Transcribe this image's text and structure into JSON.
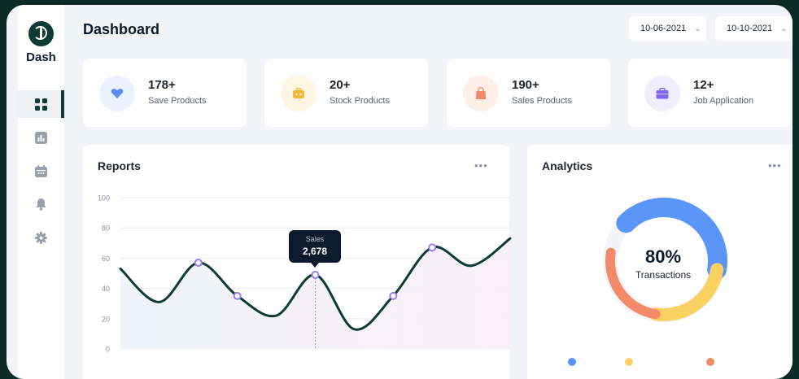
{
  "app": {
    "brand": "Dash",
    "title": "Dashboard"
  },
  "nav": [
    {
      "name": "grid-icon",
      "active": true
    },
    {
      "name": "bar-chart-icon",
      "active": false
    },
    {
      "name": "calendar-icon",
      "active": false
    },
    {
      "name": "bell-icon",
      "active": false
    },
    {
      "name": "gear-icon",
      "active": false
    }
  ],
  "dates": {
    "start": "10-06-2021",
    "end": "10-10-2021"
  },
  "stats": [
    {
      "value": "178+",
      "label": "Save Products",
      "icon": "heart-icon",
      "bg": "#ebf1fe",
      "color": "#5b8df7"
    },
    {
      "value": "20+",
      "label": "Stock Products",
      "icon": "bag-icon",
      "bg": "#fef5e2",
      "color": "#f6b73c"
    },
    {
      "value": "190+",
      "label": "Sales Products",
      "icon": "shopping-bag-icon",
      "bg": "#feefe9",
      "color": "#f38b6b"
    },
    {
      "value": "12+",
      "label": "Job Application",
      "icon": "briefcase-icon",
      "bg": "#efedfe",
      "color": "#8066f2"
    }
  ],
  "reports": {
    "title": "Reports",
    "more": "•••"
  },
  "analytics": {
    "title": "Analytics",
    "more": "•••",
    "percent": "80%",
    "label": "Transactions"
  },
  "tooltip": {
    "label": "Sales",
    "value": "2,678"
  },
  "chart_data": {
    "type": "line",
    "title": "Reports",
    "xlabel": "",
    "ylabel": "",
    "ylim": [
      0,
      100
    ],
    "yticks": [
      0,
      20,
      40,
      60,
      80,
      100
    ],
    "grid": true,
    "series": [
      {
        "points": [
          [
            0,
            53
          ],
          [
            1,
            31
          ],
          [
            2,
            57
          ],
          [
            3,
            35
          ],
          [
            4,
            22
          ],
          [
            5,
            49
          ],
          [
            6,
            13
          ],
          [
            7,
            35
          ],
          [
            8,
            67
          ],
          [
            9,
            55
          ],
          [
            10,
            73
          ]
        ]
      }
    ],
    "highlighted_points": [
      2,
      3,
      5,
      7,
      8
    ],
    "tooltip_point": 5
  },
  "donut": {
    "segments": [
      {
        "color": "#5b95f8",
        "value": 40
      },
      {
        "color": "#fbd262",
        "value": 25
      },
      {
        "color": "#f38b6b",
        "value": 25
      }
    ]
  },
  "colors": {
    "accent": "#0d3b35",
    "line": "#0d3b35",
    "point": "#9b7cf3"
  }
}
